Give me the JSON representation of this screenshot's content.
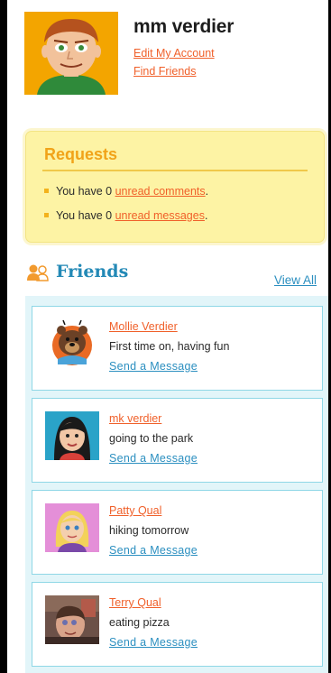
{
  "profile": {
    "name": "mm verdier",
    "edit_link": "Edit My Account",
    "find_link": "Find Friends"
  },
  "requests": {
    "title": "Requests",
    "comments": {
      "prefix": "You have 0 ",
      "link": "unread comments",
      "suffix": "."
    },
    "messages": {
      "prefix": "You have 0 ",
      "link": "unread messages",
      "suffix": "."
    }
  },
  "friends": {
    "title": "Friends",
    "view_all": "View All",
    "items": [
      {
        "name": "Mollie Verdier",
        "status": "First time on, having fun",
        "action": "Send a Message"
      },
      {
        "name": "mk verdier",
        "status": "going to the park",
        "action": "Send a Message"
      },
      {
        "name": "Patty Qual",
        "status": "hiking tomorrow",
        "action": "Send a Message"
      },
      {
        "name": "Terry Qual",
        "status": "eating pizza",
        "action": "Send a Message"
      }
    ]
  },
  "colors": {
    "link_orange": "#f0602a",
    "link_blue": "#2b8fc0",
    "requests_bg": "#fdf3a4",
    "friends_panel_bg": "#e2f5f9",
    "heading_blue": "#2389b6"
  }
}
